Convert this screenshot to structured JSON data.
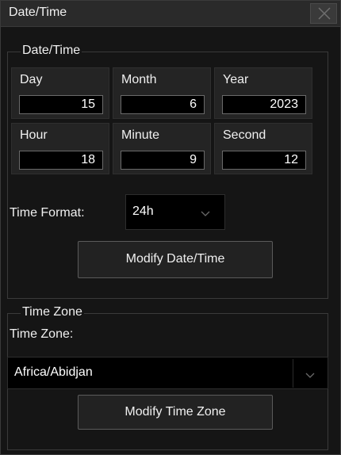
{
  "window": {
    "title": "Date/Time",
    "close_icon": "close-icon"
  },
  "datetime_group": {
    "title": "Date/Time",
    "fields": [
      {
        "label": "Day",
        "value": "15"
      },
      {
        "label": "Month",
        "value": "6"
      },
      {
        "label": "Year",
        "value": "2023"
      },
      {
        "label": "Hour",
        "value": "18"
      },
      {
        "label": "Minute",
        "value": "9"
      },
      {
        "label": "Second",
        "value": "12"
      }
    ],
    "time_format_label": "Time Format:",
    "time_format_value": "24h",
    "modify_button": "Modify Date/Time"
  },
  "timezone_group": {
    "title": "Time Zone",
    "label": "Time Zone:",
    "value": "Africa/Abidjan",
    "modify_button": "Modify Time Zone"
  },
  "colors": {
    "background": "#151515",
    "titlebar": "#2a2a2a",
    "input": "#000000",
    "text": "#f0f0f0"
  }
}
